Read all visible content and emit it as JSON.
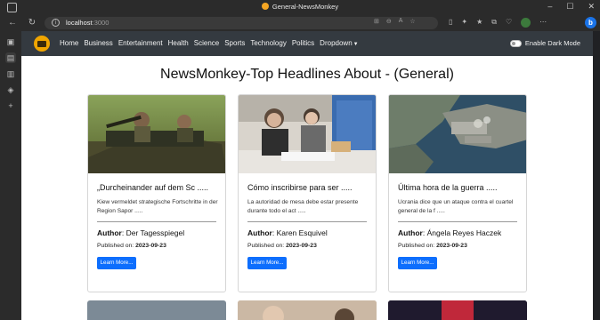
{
  "browser": {
    "tab_title": "General-NewsMonkey",
    "url_host": "localhost",
    "url_port": ":3000"
  },
  "navbar": {
    "links": [
      "Home",
      "Business",
      "Entertainment",
      "Health",
      "Science",
      "Sports",
      "Technology",
      "Politics"
    ],
    "dropdown_label": "Dropdown",
    "dark_mode_label": "Enable Dark Mode"
  },
  "page": {
    "heading": "NewsMonkey-Top Headlines About - (General)"
  },
  "cards": [
    {
      "title": "„Durcheinander auf dem Sc .....",
      "description": "Kiew vermeldet strategische Fortschritte in der Region Sapor .....",
      "author_label": "Author",
      "author": "Der Tagesspiegel",
      "published_label": "Published on:",
      "published": "2023-09-23",
      "button": "Learn More..."
    },
    {
      "title": "Cómo inscribirse para ser .....",
      "description": "La autoridad de mesa debe estar presente durante todo el act .....",
      "author_label": "Author",
      "author": "Karen Esquivel",
      "published_label": "Published on:",
      "published": "2023-09-23",
      "button": "Learn More..."
    },
    {
      "title": "Última hora de la guerra .....",
      "description": "Ucrania dice que un ataque contra el cuartel general de la f .....",
      "author_label": "Author",
      "author": "Ángela Reyes Haczek",
      "published_label": "Published on:",
      "published": "2023-09-23",
      "button": "Learn More..."
    }
  ]
}
